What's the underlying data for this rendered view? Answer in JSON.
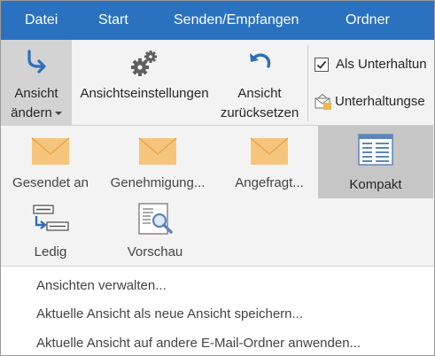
{
  "tabs": [
    {
      "label": "Datei"
    },
    {
      "label": "Start"
    },
    {
      "label": "Senden/Empfangen"
    },
    {
      "label": "Ordner"
    }
  ],
  "ribbon": {
    "change_view": {
      "line1": "Ansicht",
      "line2": "ändern",
      "icon": "change-view-icon"
    },
    "view_settings": {
      "label": "Ansichtseinstellungen",
      "icon": "gears-icon"
    },
    "reset_view": {
      "line1": "Ansicht",
      "line2": "zurücksetzen",
      "icon": "undo-arrow-icon"
    },
    "conversation_check": {
      "label": "Als Unterhaltun",
      "checked": true
    },
    "conversation_settings": {
      "label": "Unterhaltungse",
      "icon": "envelope-settings-icon"
    }
  },
  "gallery": {
    "items": [
      {
        "label": "Gesendet an",
        "icon": "envelope-icon"
      },
      {
        "label": "Genehmigung...",
        "icon": "envelope-icon"
      },
      {
        "label": "Angefragt...",
        "icon": "envelope-icon"
      },
      {
        "label": "Kompakt",
        "icon": "compact-list-icon",
        "selected": true
      },
      {
        "label": "Ledig",
        "icon": "single-list-icon"
      },
      {
        "label": "Vorschau",
        "icon": "preview-icon"
      }
    ]
  },
  "menu": {
    "items": [
      {
        "label": "Ansichten verwalten..."
      },
      {
        "label": "Aktuelle Ansicht als neue Ansicht speichern..."
      },
      {
        "label": "Aktuelle Ansicht auf andere E-Mail-Ordner anwenden..."
      }
    ]
  },
  "colors": {
    "tabbar": "#2a72c0",
    "ribbon_bg": "#f3f3f3",
    "selected_bg": "#c6c6c6",
    "envelope": "#f6c57c"
  }
}
